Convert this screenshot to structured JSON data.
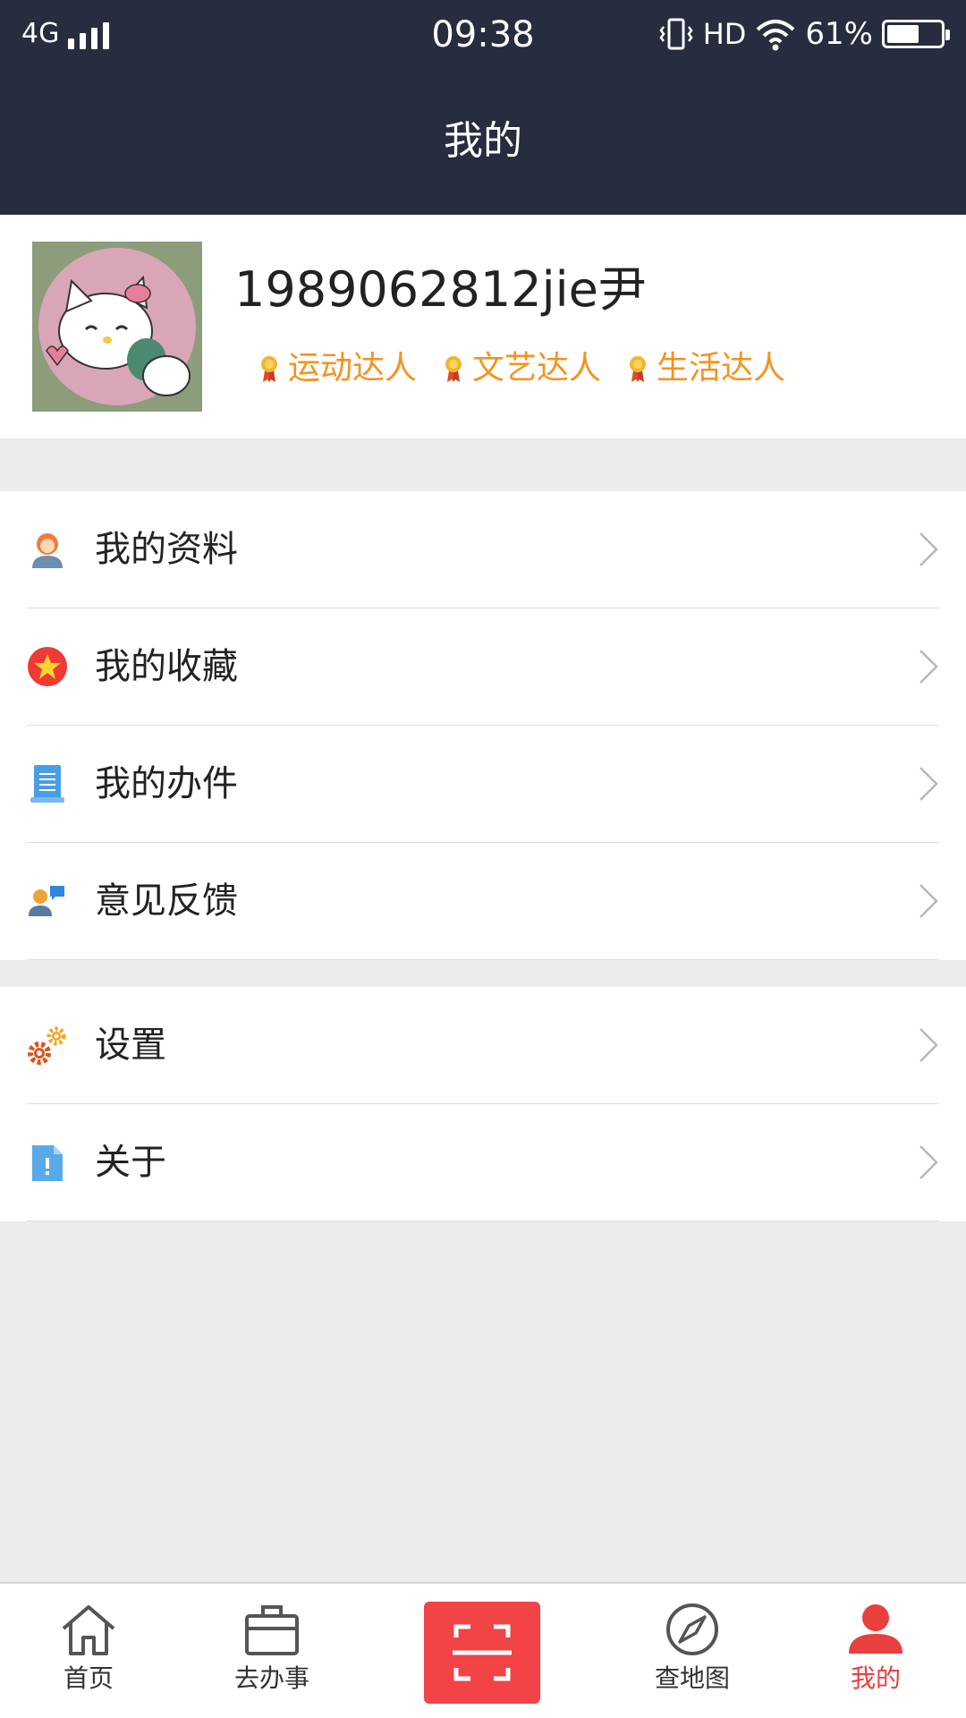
{
  "status_bar": {
    "network": "4G",
    "time": "09:38",
    "hd": "HD",
    "battery": "61%",
    "battery_level": 0.61
  },
  "header": {
    "title": "我的"
  },
  "profile": {
    "username": "1989062812jie尹",
    "tags": [
      "运动达人",
      "文艺达人",
      "生活达人"
    ]
  },
  "menu_group_1": [
    {
      "label": "我的资料",
      "icon": "user-profile-icon"
    },
    {
      "label": "我的收藏",
      "icon": "star-icon"
    },
    {
      "label": "我的办件",
      "icon": "document-icon"
    },
    {
      "label": "意见反馈",
      "icon": "feedback-icon"
    }
  ],
  "menu_group_2": [
    {
      "label": "设置",
      "icon": "gear-icon"
    },
    {
      "label": "关于",
      "icon": "info-file-icon"
    }
  ],
  "tabbar": {
    "home": "首页",
    "tasks": "去办事",
    "map": "查地图",
    "mine": "我的"
  },
  "colors": {
    "header_bg": "#282c3f",
    "accent_red": "#e8403f",
    "tag_orange": "#f4931f"
  }
}
